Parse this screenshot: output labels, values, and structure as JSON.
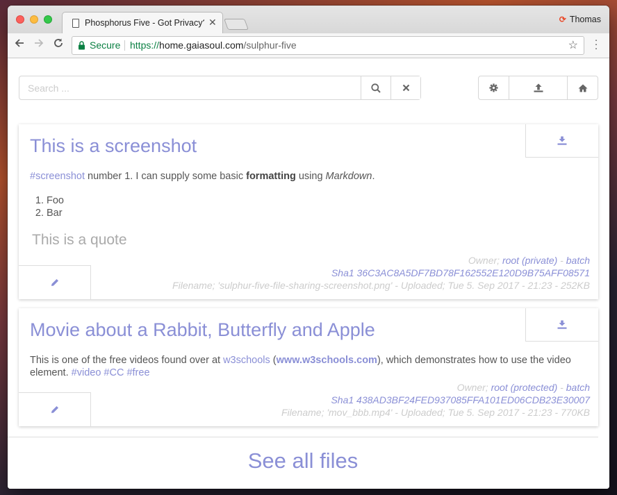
{
  "browser": {
    "tab_title": "Phosphorus Five - Got Privacy?",
    "profile_name": "Thomas",
    "secure_label": "Secure",
    "url_scheme": "https://",
    "url_host": "home.gaiasoul.com",
    "url_path": "/sulphur-five"
  },
  "toolbar": {
    "search_placeholder": "Search ...",
    "icons": [
      "search-icon",
      "clear-icon",
      "settings-icon",
      "upload-icon",
      "home-icon"
    ]
  },
  "cards": [
    {
      "title": "This is a screenshot",
      "text_tag": "#screenshot",
      "text_1": " number 1. I can supply some basic ",
      "text_bold": "formatting",
      "text_2": " using ",
      "text_em": "Markdown",
      "text_3": ".",
      "list": [
        "Foo",
        "Bar"
      ],
      "quote": "This is a quote",
      "owner_label": "Owner; ",
      "owner_value": "root (private)",
      "owner_sep": " - ",
      "batch": "batch",
      "sha": "Sha1 36C3AC8A5DF7BD78F162552E120D9B75AFF08571",
      "filename_line": "Filename; 'sulphur-five-file-sharing-screenshot.png' - Uploaded; Tue 5. Sep 2017 - 21:23 - 252KB"
    },
    {
      "title": "Movie about a Rabbit, Butterfly and Apple",
      "text_1": "This is one of the free videos found over at ",
      "link_1": "w3schools",
      "text_2": " (",
      "link_2": "www.w3schools.com",
      "text_3": "), which demonstrates how to use the video element. ",
      "tags": [
        "#video",
        "#CC",
        "#free"
      ],
      "owner_label": "Owner; ",
      "owner_value": "root (protected)",
      "owner_sep": " - ",
      "batch": "batch",
      "sha": "Sha1 438AD3BF24FED937085FFA101ED06CDB23E30007",
      "filename_line": "Filename; 'mov_bbb.mp4' - Uploaded; Tue 5. Sep 2017 - 21:23 - 770KB"
    }
  ],
  "footer": {
    "see_all": "See all files"
  },
  "colors": {
    "accent": "#8a8fd6",
    "muted": "#cccccc",
    "text": "#555555",
    "secure_green": "#0b8043"
  }
}
